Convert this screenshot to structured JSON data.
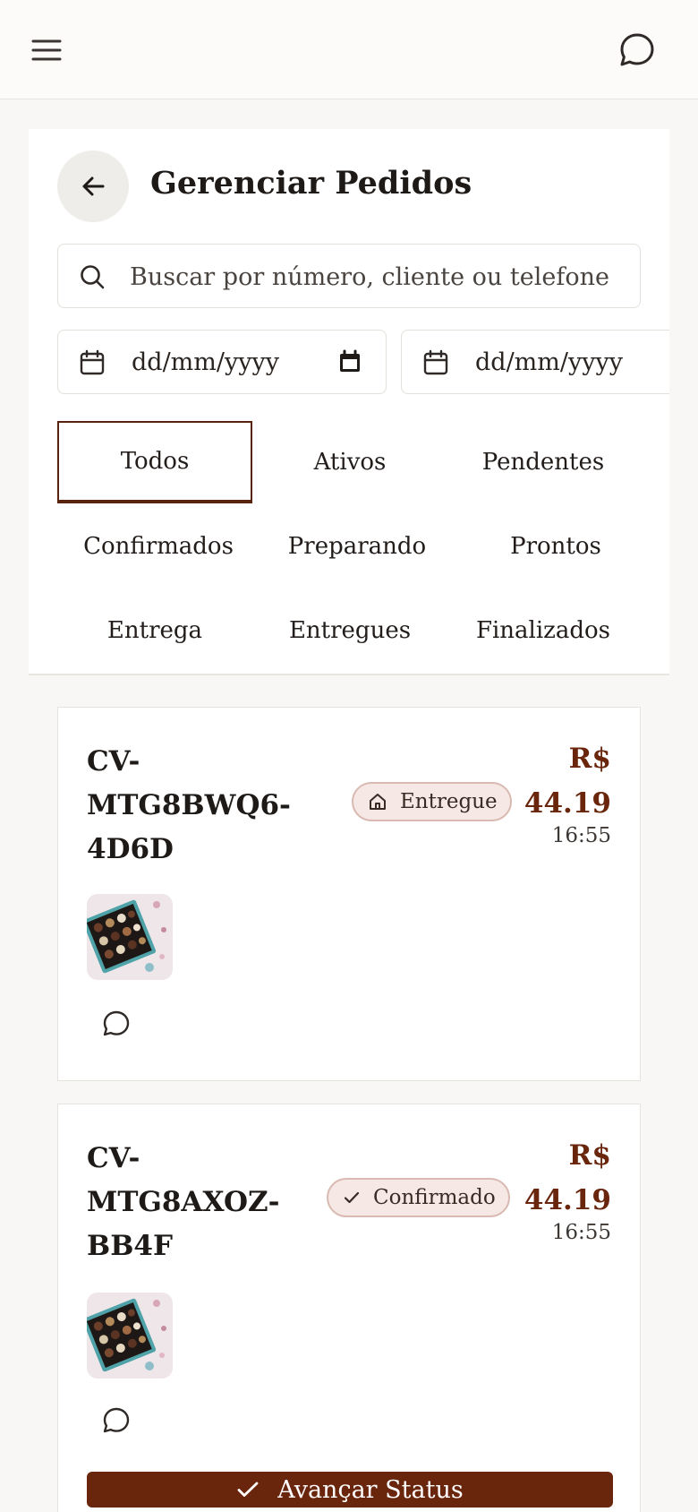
{
  "topbar": {
    "menu_icon": "hamburger-menu-icon",
    "chat_icon": "chat-bubble-icon"
  },
  "header": {
    "title": "Gerenciar Pedidos",
    "back_icon": "arrow-left-icon"
  },
  "search": {
    "placeholder": "Buscar por número, cliente ou telefone",
    "value": ""
  },
  "date_filters": [
    {
      "placeholder": "dd/mm/yyyy"
    },
    {
      "placeholder": "dd/mm/yyyy"
    }
  ],
  "status_filters": {
    "active": "Todos",
    "items": [
      "Todos",
      "Ativos",
      "Pendentes",
      "Confirmados",
      "Preparando",
      "Prontos",
      "Entrega",
      "Entregues",
      "Finalizados"
    ]
  },
  "orders": [
    {
      "id_lines": [
        "CV-",
        "MTG8BWQ6-",
        "4D6D"
      ],
      "status": "Entregue",
      "status_icon": "home-icon",
      "currency": "R$",
      "amount": "44.19",
      "time": "16:55"
    },
    {
      "id_lines": [
        "CV-",
        "MTG8AXOZ-",
        "BB4F"
      ],
      "status": "Confirmado",
      "status_icon": "check-icon",
      "currency": "R$",
      "amount": "44.19",
      "time": "16:55",
      "action_label": "Avançar Status"
    }
  ],
  "colors": {
    "brand": "#6a260d",
    "badge_bg": "#f5e8e5",
    "badge_border": "#d9b9b1"
  }
}
